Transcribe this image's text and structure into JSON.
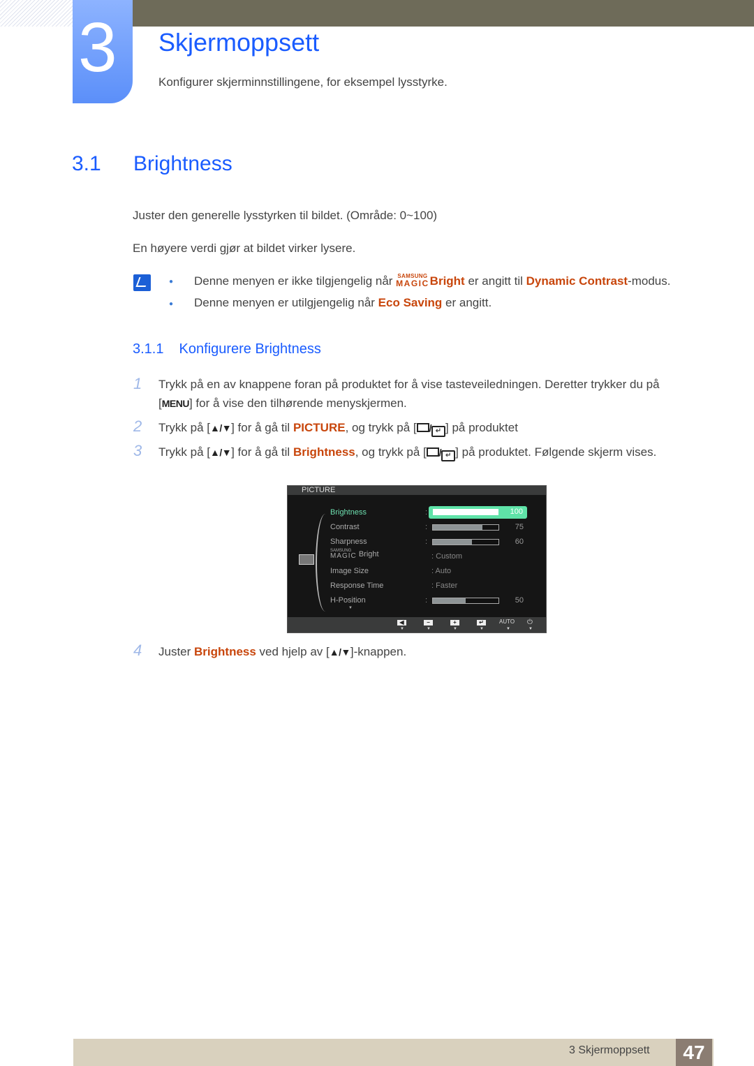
{
  "chapter": {
    "number": "3",
    "title": "Skjermoppsett",
    "subtitle": "Konfigurer skjerminnstillingene, for eksempel lysstyrke."
  },
  "section": {
    "number": "3.1",
    "title": "Brightness",
    "para1": "Juster den generelle lysstyrken til bildet. (Område: 0~100)",
    "para2": "En høyere verdi gjør at bildet virker lysere.",
    "notes": [
      {
        "pre": "Denne menyen er ikke tilgjengelig når ",
        "magic_top": "SAMSUNG",
        "magic_bottom": "MAGIC",
        "hl1": "Bright",
        "mid": " er angitt til ",
        "hl2": "Dynamic Contrast",
        "post": "-modus."
      },
      {
        "pre": "Denne menyen er utilgjengelig når ",
        "hl1": "Eco Saving",
        "post": " er angitt."
      }
    ]
  },
  "subsection": {
    "number": "3.1.1",
    "title": "Konfigurere Brightness"
  },
  "steps": [
    {
      "num": "1",
      "line1": "Trykk på en av knappene foran på produktet for å vise tasteveiledningen. Deretter trykker du på",
      "key": "MENU",
      "line2": "] for å vise den tilhørende menyskjermen."
    },
    {
      "num": "2",
      "pre": "Trykk på [",
      "arrows": "▲/▼",
      "mid": "] for å gå til ",
      "hl": "PICTURE",
      "mid2": ", og trykk på [",
      "post": "] på produktet"
    },
    {
      "num": "3",
      "pre": "Trykk på [",
      "arrows": "▲/▼",
      "mid": "] for å gå til ",
      "hl": "Brightness",
      "mid2": ", og trykk på [",
      "post": "] på produktet. Følgende skjerm vises."
    },
    {
      "num": "4",
      "pre": "Juster ",
      "hl": "Brightness",
      "mid": " ved hjelp av [",
      "arrows": "▲/▼",
      "post": "]-knappen."
    }
  ],
  "osd": {
    "title": "PICTURE",
    "rows": [
      {
        "label": "Brightness",
        "type": "bar",
        "value": 100
      },
      {
        "label": "Contrast",
        "type": "bar",
        "value": 75
      },
      {
        "label": "Sharpness",
        "type": "bar",
        "value": 60
      },
      {
        "label": "Bright",
        "magic_top": "SAMSUNG",
        "magic_bottom": "MAGIC",
        "type": "text",
        "value": "Custom"
      },
      {
        "label": "Image Size",
        "type": "text",
        "value": "Auto"
      },
      {
        "label": "Response Time",
        "type": "text",
        "value": "Faster"
      },
      {
        "label": "H-Position",
        "type": "bar",
        "value": 50
      }
    ],
    "footer_buttons": [
      "◀",
      "−",
      "+",
      "↵",
      "AUTO",
      "⏻"
    ]
  },
  "footer": {
    "text": "3 Skjermoppsett",
    "page": "47"
  }
}
